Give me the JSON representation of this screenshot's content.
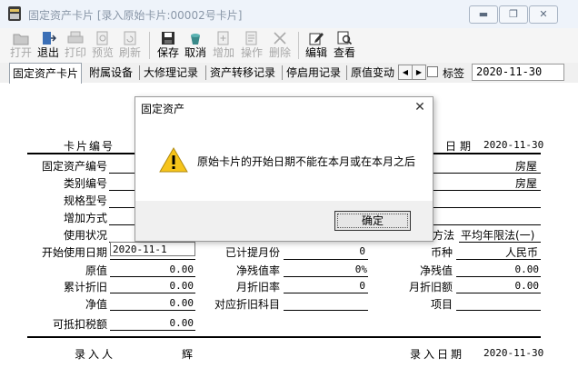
{
  "window": {
    "title": "固定资产卡片 [录入原始卡片:00002号卡片]"
  },
  "toolbar": {
    "open": "打开",
    "exit": "退出",
    "print": "打印",
    "preview": "预览",
    "refresh": "刷新",
    "save": "保存",
    "cancel": "取消",
    "add": "增加",
    "operate": "操作",
    "delete": "删除",
    "edit": "编辑",
    "view": "查看"
  },
  "tabs": [
    "固定资产卡片",
    "附属设备",
    "大修理记录",
    "资产转移记录",
    "停启用记录",
    "原值变动"
  ],
  "tag": {
    "label": "标签",
    "date": "2020-11-30"
  },
  "card": {
    "card_no_label": "卡片编号",
    "date_label": "日期",
    "date_value": "2020-11-30",
    "asset_no_label": "固定资产编号",
    "category_no_label": "类别编号",
    "spec_label": "规格型号",
    "add_method_label": "增加方式",
    "use_status_label": "使用状况",
    "start_date_label": "开始使用日期",
    "start_date_value": "2020-11-1",
    "original_value_label": "原值",
    "original_value": "0.00",
    "accum_dep_label": "累计折旧",
    "accum_dep": "0.00",
    "net_value_label": "净值",
    "net_value": "0.00",
    "deductible_tax_label": "可抵扣税额",
    "deductible_tax": "0.00",
    "months_accrued_label": "已计提月份",
    "months_accrued": "0",
    "residual_rate_label": "净残值率",
    "residual_rate": "0%",
    "monthly_rate_label": "月折旧率",
    "monthly_rate": "0",
    "account_label": "对应折旧科目",
    "house_1": "房屋",
    "house_2": "房屋",
    "method_label": "方法",
    "method_value": "平均年限法(一)",
    "currency_label": "币种",
    "currency_value": "人民币",
    "residual_label": "净残值",
    "residual_value": "0.00",
    "monthly_amount_label": "月折旧额",
    "monthly_amount": "0.00",
    "project_label": "项目",
    "entered_by_label": "录入人",
    "entered_by_value": "辉",
    "entry_date_label": "录入日期",
    "entry_date_value": "2020-11-30"
  },
  "dialog": {
    "title": "固定资产",
    "message": "原始卡片的开始日期不能在本月或在本月之后",
    "ok_label": "确定"
  }
}
